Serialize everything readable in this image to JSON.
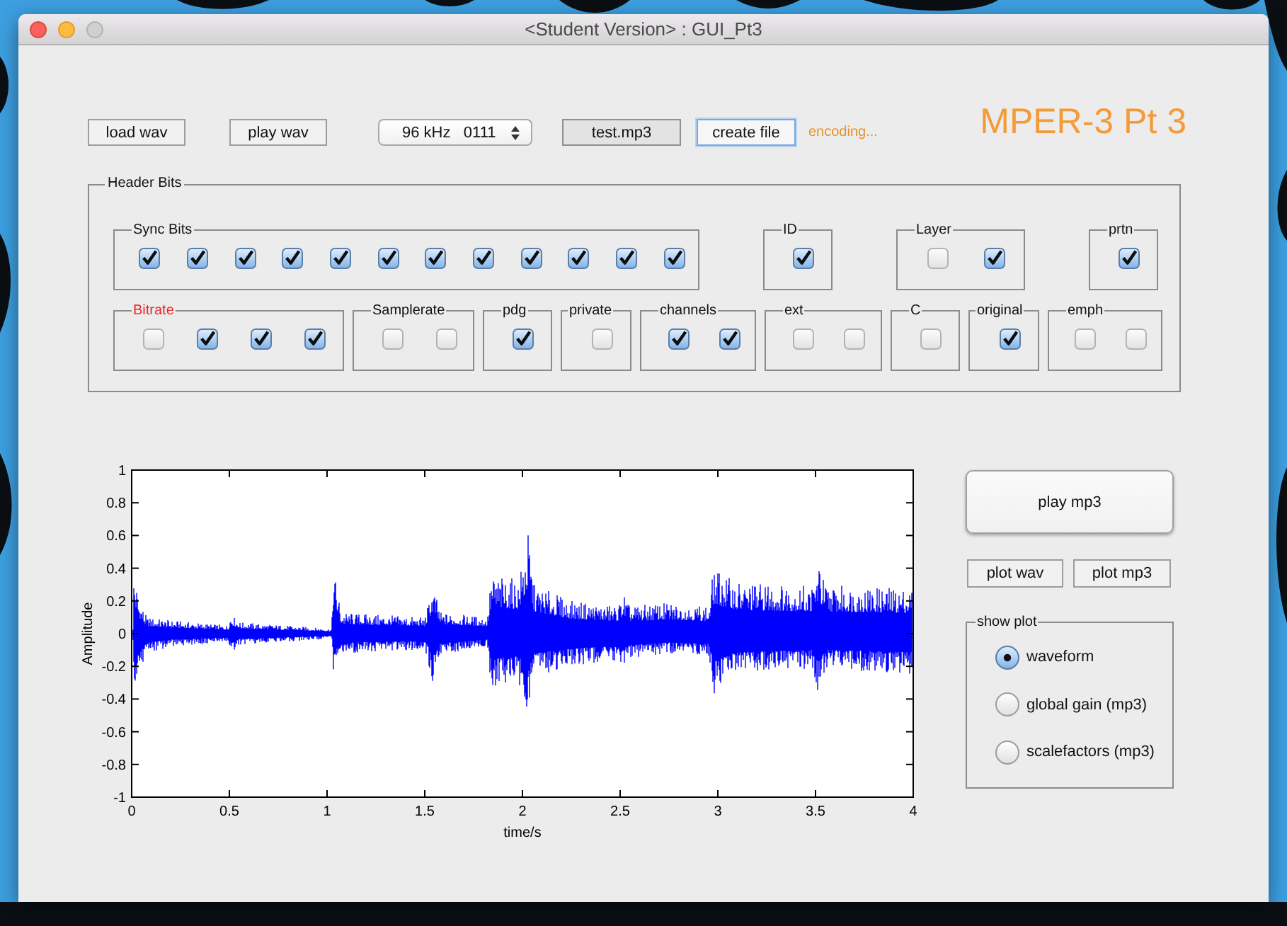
{
  "window": {
    "title": "<Student Version> : GUI_Pt3"
  },
  "toolbar": {
    "load_button": "load wav",
    "play_button": "play wav",
    "rate_popup": "96 kHz   0111",
    "file_field": "test.mp3",
    "create_button": {
      "label": "create file",
      "focused": true
    },
    "status": "encoding..."
  },
  "app_title": "MPER-3 Pt 3",
  "header_bits": {
    "title": "Header Bits",
    "rows": [
      {
        "groups": [
          {
            "label": "Sync Bits",
            "alert": false,
            "bits": [
              {
                "checked": true
              },
              {
                "checked": true
              },
              {
                "checked": true
              },
              {
                "checked": true
              },
              {
                "checked": true
              },
              {
                "checked": true
              },
              {
                "checked": true
              },
              {
                "checked": true
              },
              {
                "checked": true
              },
              {
                "checked": true
              },
              {
                "checked": true
              },
              {
                "checked": true
              }
            ]
          },
          {
            "label": "ID",
            "alert": false,
            "bits": [
              {
                "checked": true
              }
            ]
          },
          {
            "label": "Layer",
            "alert": false,
            "bits": [
              {
                "checked": false
              },
              {
                "checked": true
              }
            ]
          },
          {
            "label": "prtn",
            "alert": false,
            "bits": [
              {
                "checked": true
              }
            ]
          }
        ]
      },
      {
        "groups": [
          {
            "label": "Bitrate",
            "alert": true,
            "bits": [
              {
                "checked": false
              },
              {
                "checked": true
              },
              {
                "checked": true
              },
              {
                "checked": true
              }
            ]
          },
          {
            "label": "Samplerate",
            "alert": false,
            "bits": [
              {
                "checked": false
              },
              {
                "checked": false
              }
            ]
          },
          {
            "label": "pdg",
            "alert": false,
            "bits": [
              {
                "checked": true
              }
            ]
          },
          {
            "label": "private",
            "alert": false,
            "bits": [
              {
                "checked": false
              }
            ]
          },
          {
            "label": "channels",
            "alert": false,
            "bits": [
              {
                "checked": true
              },
              {
                "checked": true
              }
            ]
          },
          {
            "label": "ext",
            "alert": false,
            "bits": [
              {
                "checked": false
              },
              {
                "checked": false
              }
            ]
          },
          {
            "label": "C",
            "alert": false,
            "bits": [
              {
                "checked": false
              }
            ]
          },
          {
            "label": "original",
            "alert": false,
            "bits": [
              {
                "checked": true
              }
            ]
          },
          {
            "label": "emph",
            "alert": false,
            "bits": [
              {
                "checked": false
              },
              {
                "checked": false
              }
            ]
          }
        ]
      }
    ]
  },
  "plot": {
    "xlabel": "time/s",
    "ylabel": "Amplitude",
    "xtick_labels": [
      "0",
      "0.5",
      "1",
      "1.5",
      "2",
      "2.5",
      "3",
      "3.5",
      "4"
    ],
    "ytick_labels": [
      "1",
      "0.8",
      "0.6",
      "0.4",
      "0.2",
      "0",
      "-0.2",
      "-0.4",
      "-0.6",
      "-0.8",
      "-1"
    ]
  },
  "play_mp3_button": "play mp3",
  "plot_buttons": [
    "plot wav",
    "plot mp3"
  ],
  "show_plot": {
    "title": "show plot",
    "options": [
      {
        "label": "waveform",
        "selected": true
      },
      {
        "label": "global gain (mp3)",
        "selected": false
      },
      {
        "label": "scalefactors (mp3)",
        "selected": false
      }
    ]
  }
}
